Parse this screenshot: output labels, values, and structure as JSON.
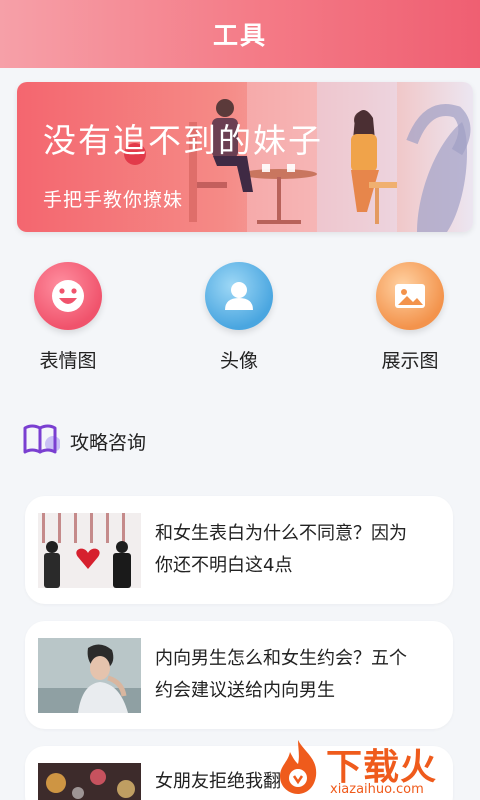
{
  "header": {
    "title": "工具"
  },
  "banner": {
    "title": "没有追不到的妹子",
    "subtitle": "手把手教你撩妹"
  },
  "quick_actions": [
    {
      "label": "表情图",
      "icon": "smiley-icon",
      "color": "#f0536c"
    },
    {
      "label": "头像",
      "icon": "user-avatar-icon",
      "color": "#4aa6e0"
    },
    {
      "label": "展示图",
      "icon": "image-icon",
      "color": "#f3934c"
    }
  ],
  "section": {
    "label": "攻略咨询",
    "icon": "book-icon"
  },
  "articles": [
    {
      "title": "和女生表白为什么不同意？因为你还不明白这4点"
    },
    {
      "title": "内向男生怎么和女生约会？五个约会建议送给内向男生"
    },
    {
      "title": "女朋友拒绝我翻"
    }
  ],
  "watermark": {
    "text": "下载火",
    "url": "xiazaihuo.com"
  }
}
